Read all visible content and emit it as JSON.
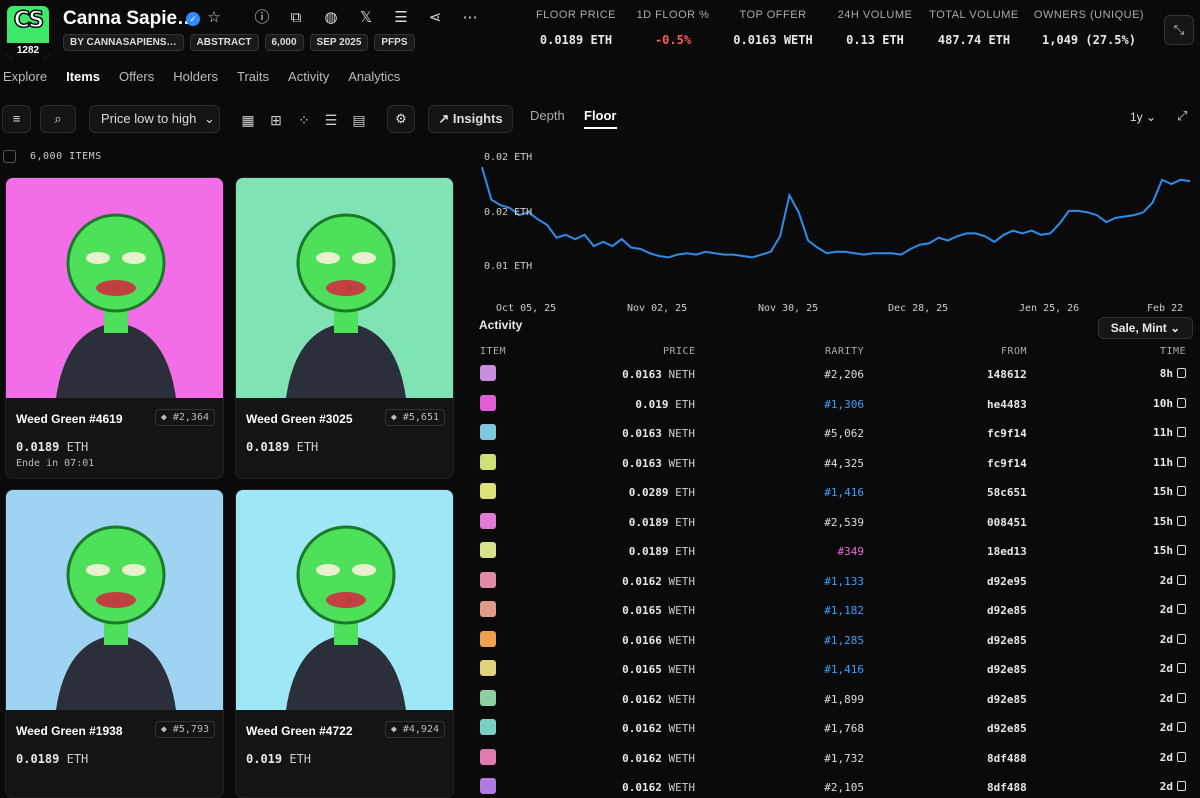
{
  "collection": {
    "logo_text": "CS",
    "logo_count": "1282",
    "name": "Canna Sapie…",
    "chips": [
      "BY CANNASAPIENS…",
      "ABSTRACT",
      "6,000",
      "SEP 2025",
      "PFPS"
    ]
  },
  "stats": [
    {
      "label": "FLOOR PRICE",
      "value": "0.0189 ETH"
    },
    {
      "label": "1D FLOOR %",
      "value": "-0.5%",
      "color": "#ff5a5a"
    },
    {
      "label": "TOP OFFER",
      "value": "0.0163 WETH"
    },
    {
      "label": "24H VOLUME",
      "value": "0.13 ETH"
    },
    {
      "label": "TOTAL VOLUME",
      "value": "487.74 ETH"
    },
    {
      "label": "OWNERS (UNIQUE)",
      "value": "1,049 (27.5%)"
    }
  ],
  "nav": [
    "Explore",
    "Items",
    "Offers",
    "Holders",
    "Traits",
    "Activity",
    "Analytics"
  ],
  "toolbar": {
    "sort": "Price low to high",
    "insights": "Insights",
    "tab_depth": "Depth",
    "tab_floor": "Floor",
    "range": "1y"
  },
  "items_count": "6,000 ITEMS",
  "cards": [
    {
      "name": "Weed Green #4619",
      "rank": "#2,364",
      "price": "0.0189",
      "unit": "ETH",
      "ends": "Ende in 07:01",
      "bg": "#f36de8"
    },
    {
      "name": "Weed Green #3025",
      "rank": "#5,651",
      "price": "0.0189",
      "unit": "ETH",
      "bg": "#7fe3b6"
    },
    {
      "name": "Weed Green #1938",
      "rank": "#5,793",
      "price": "0.0189",
      "unit": "ETH",
      "bg": "#9fd3f2"
    },
    {
      "name": "Weed Green #4722",
      "rank": "#4,924",
      "price": "0.019",
      "unit": "ETH",
      "bg": "#9ee7f7"
    }
  ],
  "chart_data": {
    "type": "line",
    "series": [
      {
        "color": "#2f8de8",
        "values": [
          0.0195,
          0.0172,
          0.0168,
          0.0166,
          0.0161,
          0.0163,
          0.0158,
          0.0154,
          0.0145,
          0.0147,
          0.0144,
          0.0147,
          0.0139,
          0.0142,
          0.0139,
          0.0144,
          0.0138,
          0.0137,
          0.0134,
          0.0132,
          0.0131,
          0.0133,
          0.0134,
          0.0133,
          0.0135,
          0.0134,
          0.0133,
          0.0133,
          0.0132,
          0.0131,
          0.0133,
          0.0135,
          0.0146,
          0.0175,
          0.0163,
          0.0143,
          0.0138,
          0.0134,
          0.0135,
          0.0135,
          0.0134,
          0.0133,
          0.0134,
          0.0134,
          0.0134,
          0.0133,
          0.0137,
          0.014,
          0.0141,
          0.0145,
          0.0143,
          0.0146,
          0.0148,
          0.0148,
          0.0146,
          0.0142,
          0.0147,
          0.015,
          0.0148,
          0.015,
          0.0147,
          0.0148,
          0.0155,
          0.0164,
          0.0164,
          0.0163,
          0.0161,
          0.0156,
          0.0159,
          0.016,
          0.0161,
          0.0163,
          0.017,
          0.0186,
          0.0183,
          0.0186,
          0.0185
        ]
      }
    ],
    "y_ticks": [
      "0.02 ETH",
      "0.02 ETH",
      "0.01 ETH"
    ],
    "x_ticks": [
      "Oct 05, 25",
      "Nov 02, 25",
      "Nov 30, 25",
      "Dec 28, 25",
      "Jen 25, 26",
      "Feb 22"
    ],
    "ylim": [
      0.0115,
      0.0205
    ]
  },
  "activity": {
    "title": "Activity",
    "filter": "Sale, Mint",
    "headers": [
      "ITEM",
      "PRICE",
      "RARITY",
      "FROM",
      "TIME"
    ],
    "rows": [
      {
        "price": "0.0163",
        "unit": "NETH",
        "rarity": "#2,206",
        "from": "148612",
        "time": "8h",
        "thumb": "#c98de0"
      },
      {
        "price": "0.019",
        "unit": "ETH",
        "rarity": "#1,306",
        "rc": "#3aa0ff",
        "from": "he4483",
        "time": "10h",
        "thumb": "#e05fd4"
      },
      {
        "price": "0.0163",
        "unit": "NETH",
        "rarity": "#5,062",
        "from": "fc9f14",
        "time": "11h",
        "thumb": "#7fc9e0"
      },
      {
        "price": "0.0163",
        "unit": "WETH",
        "rarity": "#4,325",
        "from": "fc9f14",
        "time": "11h",
        "thumb": "#cfe07a"
      },
      {
        "price": "0.0289",
        "unit": "ETH",
        "rarity": "#1,416",
        "rc": "#3aa0ff",
        "from": "58c651",
        "time": "15h",
        "thumb": "#e0e07a"
      },
      {
        "price": "0.0189",
        "unit": "ETH",
        "rarity": "#2,539",
        "from": "008451",
        "time": "15h",
        "thumb": "#e07ad6"
      },
      {
        "price": "0.0189",
        "unit": "ETH",
        "rarity": "#349",
        "rc": "#e06de0",
        "from": "18ed13",
        "time": "15h",
        "thumb": "#d8e08a"
      },
      {
        "price": "0.0162",
        "unit": "WETH",
        "rarity": "#1,133",
        "rc": "#3aa0ff",
        "from": "d92e95",
        "time": "2d",
        "thumb": "#e08aa8"
      },
      {
        "price": "0.0165",
        "unit": "WETH",
        "rarity": "#1,182",
        "rc": "#3aa0ff",
        "from": "d92e85",
        "time": "2d",
        "thumb": "#e09a8a"
      },
      {
        "price": "0.0166",
        "unit": "WETH",
        "rarity": "#1,285",
        "rc": "#3aa0ff",
        "from": "d92e85",
        "time": "2d",
        "thumb": "#f0a050"
      },
      {
        "price": "0.0165",
        "unit": "WETH",
        "rarity": "#1,416",
        "rc": "#3aa0ff",
        "from": "d92e85",
        "time": "2d",
        "thumb": "#e0d080"
      },
      {
        "price": "0.0162",
        "unit": "WETH",
        "rarity": "#1,899",
        "from": "d92e85",
        "time": "2d",
        "thumb": "#8ad0a0"
      },
      {
        "price": "0.0162",
        "unit": "WETH",
        "rarity": "#1,768",
        "from": "d92e85",
        "time": "2d",
        "thumb": "#7ad0c0"
      },
      {
        "price": "0.0162",
        "unit": "WETH",
        "rarity": "#1,732",
        "from": "8df488",
        "time": "2d",
        "thumb": "#e07ab0"
      },
      {
        "price": "0.0162",
        "unit": "WETH",
        "rarity": "#2,105",
        "from": "8df488",
        "time": "2d",
        "thumb": "#b07ae0"
      }
    ]
  }
}
